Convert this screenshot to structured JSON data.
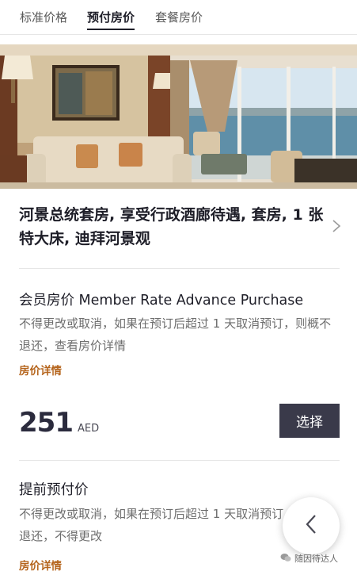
{
  "tabs": [
    {
      "label": "标准价格",
      "active": false
    },
    {
      "label": "预付房价",
      "active": true
    },
    {
      "label": "套餐房价",
      "active": false
    }
  ],
  "room": {
    "title": "河景总统套房, 享受行政酒廊待遇, 套房, 1  张特大床, 迪拜河景观"
  },
  "rates": [
    {
      "name": "会员房价 Member Rate Advance Purchase",
      "description": "不得更改或取消，如果在预订后超过 1 天取消预订，则概不退还，查看房价详情",
      "details_link": "房价详情",
      "price": "251",
      "currency": "AED",
      "select_label": "选择"
    },
    {
      "name": "提前预付价",
      "description": "不得更改或取消，如果在预订后超过 1 天取消预订，则概不退还，不得更改",
      "details_link": "房价详情"
    }
  ],
  "watermark": {
    "text": "随因待达人"
  },
  "icons": {
    "chevron": "chevron-right-icon",
    "back": "chevron-left-icon",
    "watermark": "wechat-icon"
  },
  "colors": {
    "accent": "#b5651d",
    "button": "#3a3a4a",
    "text": "#1e1e28"
  }
}
